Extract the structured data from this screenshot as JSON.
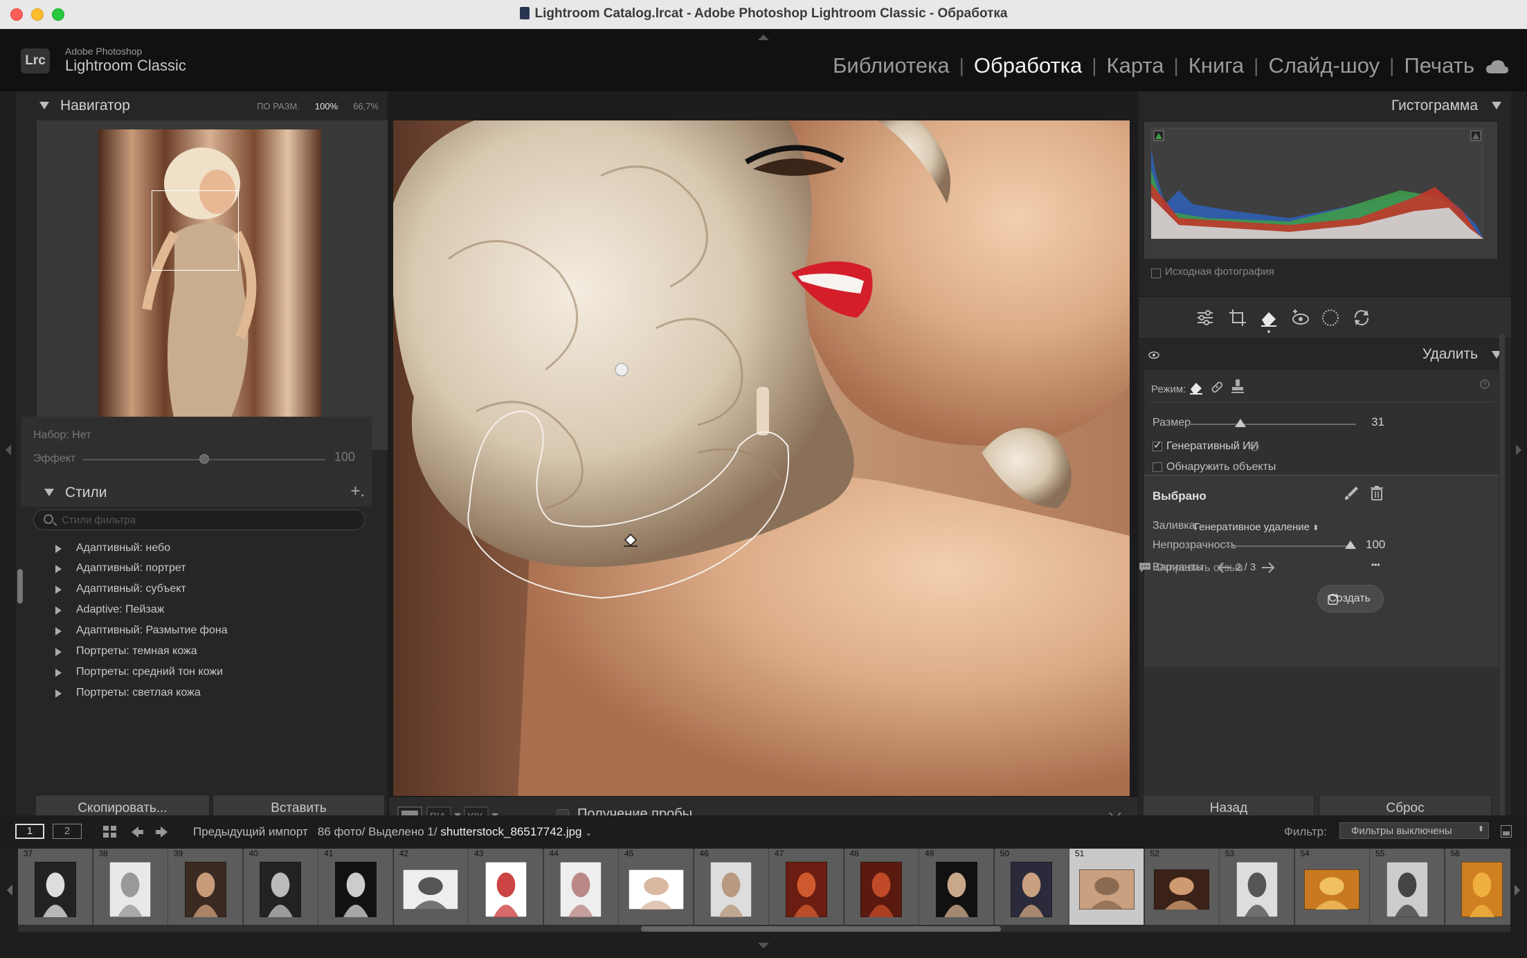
{
  "window": {
    "title": "Lightroom Catalog.lrcat - Adobe Photoshop Lightroom Classic - Обработка"
  },
  "identity": {
    "logo": "Lrc",
    "brand_small": "Adobe Photoshop",
    "brand_big": "Lightroom Classic"
  },
  "modules": [
    {
      "label": "Библиотека",
      "active": false
    },
    {
      "label": "Обработка",
      "active": true
    },
    {
      "label": "Карта",
      "active": false
    },
    {
      "label": "Книга",
      "active": false
    },
    {
      "label": "Слайд-шоу",
      "active": false
    },
    {
      "label": "Печать",
      "active": false
    }
  ],
  "navigator": {
    "title": "Навигатор",
    "zoom_fit": "ПО РАЗМ.",
    "zoom_100": "100%",
    "zoom_custom": "66,7%"
  },
  "preset": {
    "set_label": "Набор: Нет",
    "effect_label": "Эффект",
    "effect_value": "100",
    "effect_level": 0.5
  },
  "styles": {
    "title": "Стили",
    "plus": "+.",
    "search_placeholder": "Стили фильтра",
    "items": [
      "Адаптивный: небо",
      "Адаптивный: портрет",
      "Адаптивный: субъект",
      "Adaptive: Пейзаж",
      "Адаптивный: Размытие фона",
      "Портреты: темная кожа",
      "Портреты: средний тон кожи",
      "Портреты: светлая кожа"
    ]
  },
  "left_buttons": {
    "copy": "Скопировать...",
    "paste": "Вставить"
  },
  "toolbar": {
    "probe_label": "Получение пробы"
  },
  "histogram": {
    "title": "Гистограмма",
    "original_label": "Исходная фотография"
  },
  "remove": {
    "title": "Удалить",
    "mode_label": "Режим:",
    "size_label": "Размер",
    "size_value": "31",
    "size_level": 0.31,
    "gen_ai_label": "Генеративный ИИ",
    "gen_ai_checked": true,
    "detect_label": "Обнаружить объекты",
    "detect_checked": false
  },
  "selected": {
    "title": "Выбрано",
    "fill_label": "Заливка:",
    "fill_value": "Генеративное удаление",
    "opacity_label": "Непрозрачность",
    "opacity_value": "100",
    "opacity_level": 1.0,
    "variants_label": "Варианты",
    "variants_value": "2 / 3",
    "more": "•••",
    "create_label": "Создать"
  },
  "feedback_label": "Отправить отзыв",
  "right_buttons": {
    "back": "Назад",
    "reset": "Сброс"
  },
  "filmbar": {
    "page1": "1",
    "page2": "2",
    "source": "Предыдущий импорт",
    "count": "86 фото/",
    "selected": "Выделено 1/",
    "filename": "shutterstock_86517742.jpg",
    "filter_label": "Фильтр:",
    "filter_value": "Фильтры выключены"
  },
  "filmstrip": {
    "numbers": [
      "37",
      "38",
      "39",
      "40",
      "41",
      "42",
      "43",
      "44",
      "45",
      "46",
      "47",
      "48",
      "49",
      "50",
      "51",
      "52",
      "53",
      "54",
      "55",
      "56"
    ],
    "selected_index": 14
  },
  "colors": {
    "accent": "#e8e8e8",
    "panel": "#262626",
    "hist_red": "#c0392b",
    "hist_green": "#3f9a4a",
    "hist_blue": "#2f5fb3"
  }
}
